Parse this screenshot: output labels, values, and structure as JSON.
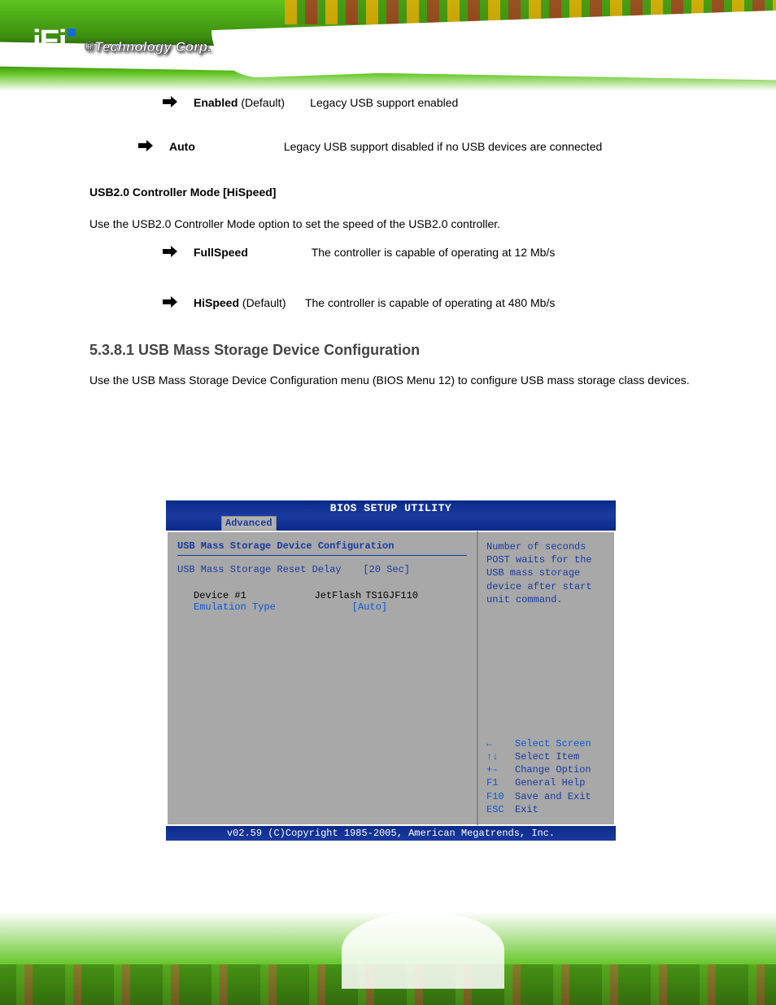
{
  "logo": {
    "brand": "iEi",
    "tagline": "®Technology Corp."
  },
  "bullets": [
    {
      "head": "Enabled",
      "tail_default": " (Default)",
      "text": "Legacy USB support enabled"
    },
    {
      "head": "Auto",
      "text": "Legacy USB support disabled if no USB devices are connected"
    }
  ],
  "heading": "USB2.0 Controller Mode [HiSpeed]",
  "heading_desc": "Use the USB2.0 Controller Mode option to set the speed of the USB2.0 controller.",
  "sub_bullets": [
    {
      "head": "FullSpeed",
      "text": "The controller is capable of operating at 12 Mb/s"
    },
    {
      "head": "HiSpeed",
      "tail_default": " (Default)",
      "text": "The controller is capable of operating at 480 Mb/s"
    }
  ],
  "subsection_title": "5.3.8.1 USB Mass Storage Device Configuration",
  "subsection_desc": "Use the USB Mass Storage Device Configuration menu (BIOS Menu 12) to configure USB mass storage class devices.",
  "bios": {
    "title": "BIOS SETUP UTILITY",
    "tab": "Advanced",
    "section_title": "USB Mass Storage Device Configuration",
    "reset_label": "USB Mass Storage Reset Delay",
    "reset_value": "[20 Sec]",
    "device_label": "Device #1",
    "device_mid": "JetFlash",
    "device_val": "TS1GJF110",
    "emulation_label": "Emulation Type",
    "emulation_value": "[Auto]",
    "help_text": "Number of seconds POST waits for the USB mass storage device after start unit command.",
    "keys": [
      {
        "k": "←",
        "v": "Select Screen",
        "blue": true
      },
      {
        "k": "↑↓",
        "v": "Select Item"
      },
      {
        "k": "+-",
        "v": "Change Option"
      },
      {
        "k": "F1",
        "v": "General Help"
      },
      {
        "k": "F10",
        "v": "Save and Exit"
      },
      {
        "k": "ESC",
        "v": "Exit"
      }
    ],
    "footer": "v02.59 (C)Copyright 1985-2005, American Megatrends, Inc."
  }
}
